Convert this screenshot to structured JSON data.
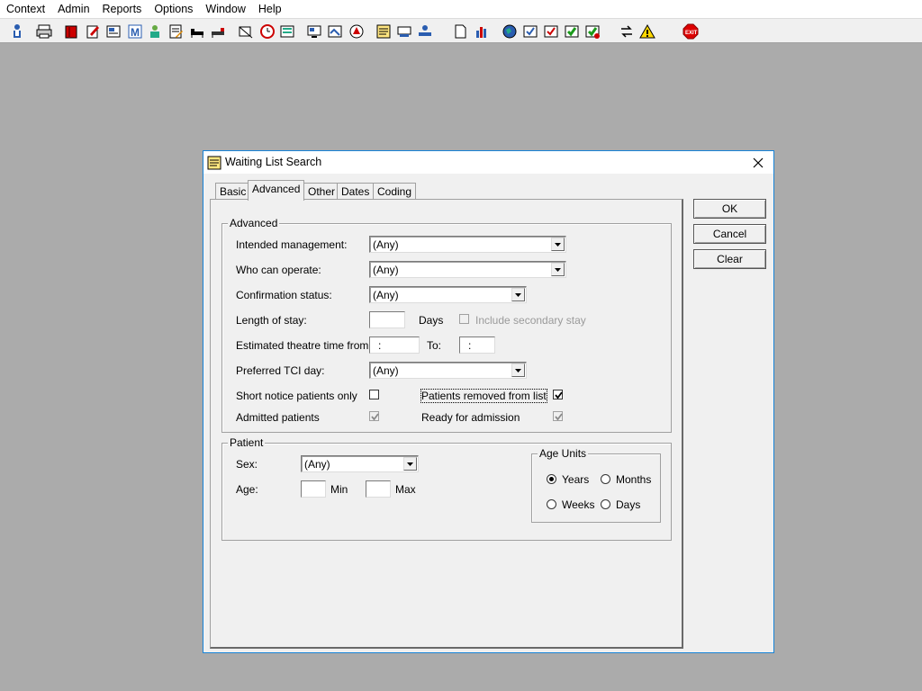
{
  "menubar": {
    "items": [
      "Context",
      "Admin",
      "Reports",
      "Options",
      "Window",
      "Help"
    ]
  },
  "toolbar": {
    "icons": [
      "patient-icon",
      "print-icon",
      "book-icon",
      "notes-edit-icon",
      "form-icon",
      "letter-m-icon",
      "doctor-icon",
      "document-edit-icon",
      "ward-icon",
      "bed-icon",
      "theatre-icon",
      "clock-icon",
      "list-icon",
      "screen-icon",
      "form2-icon",
      "search-circle-icon",
      "note-icon",
      "transfer-icon",
      "bed-list-icon",
      "page-icon",
      "bar-chart-icon",
      "globe-icon",
      "checklist-icon",
      "check-icon",
      "check-green-icon",
      "check-alt-icon",
      "swap-icon",
      "warning-icon",
      "exit-icon"
    ]
  },
  "dialog": {
    "title": "Waiting List Search",
    "tabs": [
      "Basic",
      "Advanced",
      "Other",
      "Dates",
      "Coding"
    ],
    "active_tab": "Advanced",
    "buttons": {
      "ok": "OK",
      "cancel": "Cancel",
      "clear": "Clear"
    },
    "advanced": {
      "group_title": "Advanced",
      "intended_management": {
        "label": "Intended management:",
        "value": "(Any)"
      },
      "who_can_operate": {
        "label": "Who can operate:",
        "value": "(Any)"
      },
      "confirmation_status": {
        "label": "Confirmation status:",
        "value": "(Any)"
      },
      "length_of_stay": {
        "label": "Length of stay:",
        "value": "",
        "unit": "Days"
      },
      "include_secondary": {
        "label": "Include secondary stay",
        "checked": false,
        "enabled": false
      },
      "theatre_time": {
        "label": "Estimated theatre time from:",
        "from": ":",
        "to_label": "To:",
        "to": ":"
      },
      "preferred_tci_day": {
        "label": "Preferred TCI day:",
        "value": "(Any)"
      },
      "short_notice": {
        "label": "Short notice patients only",
        "checked": false
      },
      "patients_removed": {
        "label": "Patients removed from list",
        "checked": true
      },
      "admitted": {
        "label": "Admitted patients",
        "checked": true,
        "enabled": false
      },
      "ready_for_admission": {
        "label": "Ready for admission",
        "checked": true,
        "enabled": false
      }
    },
    "patient": {
      "group_title": "Patient",
      "sex": {
        "label": "Sex:",
        "value": "(Any)"
      },
      "age": {
        "label": "Age:",
        "min": "",
        "min_label": "Min",
        "max": "",
        "max_label": "Max"
      },
      "age_units": {
        "title": "Age Units",
        "options": [
          "Years",
          "Months",
          "Weeks",
          "Days"
        ],
        "selected": "Years"
      }
    }
  }
}
